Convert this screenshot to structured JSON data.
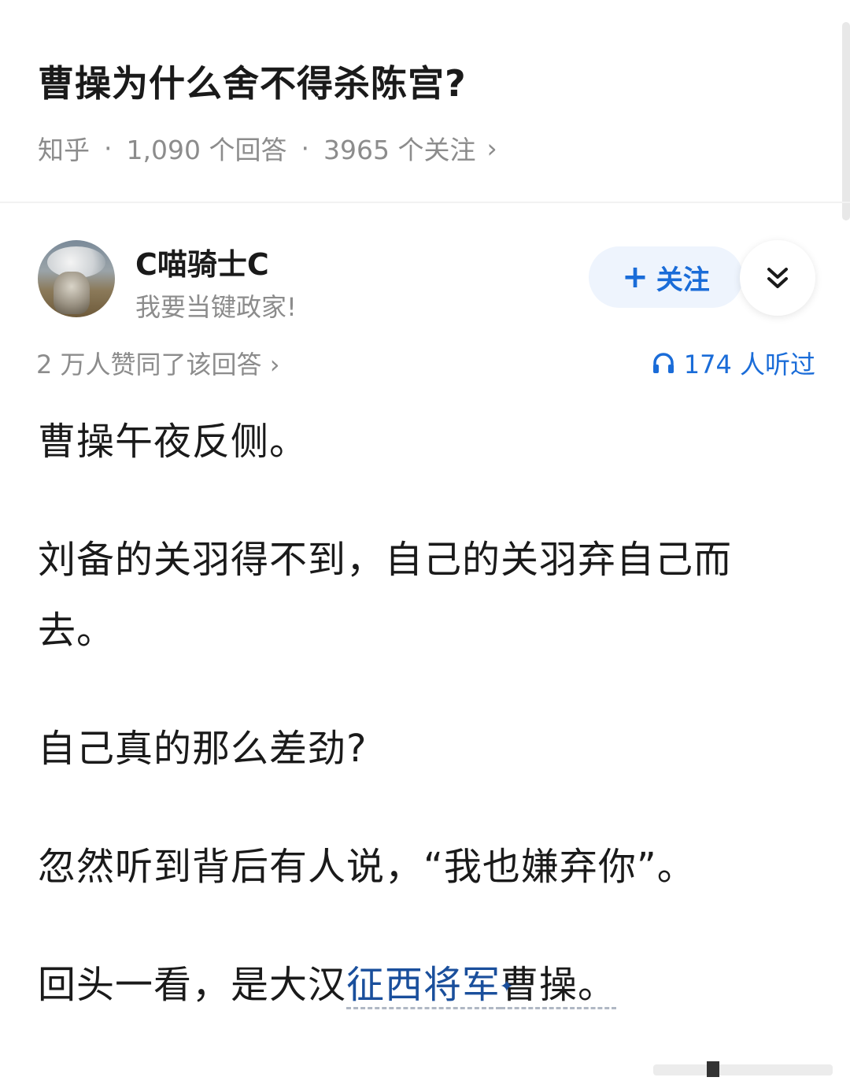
{
  "question": {
    "title": "曹操为什么舍不得杀陈宫?",
    "source": "知乎",
    "answers_count": "1,090 个回答",
    "followers_count": "3965 个关注",
    "chevron": "›"
  },
  "author": {
    "name": "C喵骑士C",
    "bio": "我要当键政家!",
    "follow_label": "关注",
    "follow_plus": "+",
    "avatar_icon": "cat-photo-avatar"
  },
  "stats": {
    "likes": "2 万人赞同了该回答 ›",
    "listens": "174 人听过"
  },
  "answer": {
    "p1": "曹操午夜反侧。",
    "p2": "刘备的关羽得不到，自己的关羽弃自己而去。",
    "p3": "自己真的那么差劲?",
    "p4": "忽然听到背后有人说，“我也嫌弃你”。",
    "p5_before": "回头一看，是大汉",
    "p5_link": "征西将军",
    "p5_link_spark": "✦",
    "p5_after": "曹操。"
  },
  "colors": {
    "accent": "#1a6cd8",
    "link": "#1a4f9c",
    "muted": "#8c8c8c"
  }
}
